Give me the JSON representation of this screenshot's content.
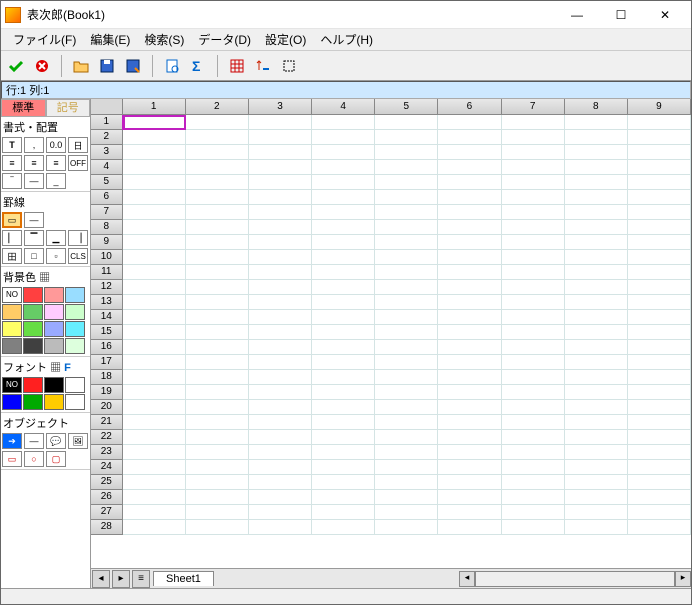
{
  "title": "表次郎(Book1)",
  "menu": {
    "file": "ファイル(F)",
    "edit": "編集(E)",
    "search": "検索(S)",
    "data": "データ(D)",
    "settings": "設定(O)",
    "help": "ヘルプ(H)"
  },
  "location": "行:1 列:1",
  "side": {
    "tab_standard": "標準",
    "tab_symbol": "記号",
    "sect_format": "書式・配置",
    "sect_border": "罫線",
    "sect_bg": "背景色",
    "sect_font": "フォント",
    "sect_object": "オブジェクト",
    "fmt_off": "OFF",
    "cls": "CLS",
    "no": "NO",
    "t_btn": "T",
    "comma_btn": ",",
    "dec_btn": "0.0",
    "date_btn": "日",
    "field_btn": "田"
  },
  "bg_colors": [
    "#ffffff",
    "#ff4040",
    "#ff9999",
    "#99ddff",
    "#ffcc66",
    "#66cc66",
    "#ffccff",
    "#ccffcc",
    "#ffff66",
    "#66dd44",
    "#99aaff",
    "#66eeff",
    "#808080",
    "#404040",
    "#bbbbbb",
    "#ddffdd"
  ],
  "font_colors": [
    "#000000",
    "#ff2020",
    "#000000",
    "#ffffff",
    "#0000ff",
    "#00aa00",
    "#ffcc00",
    "#ffffff"
  ],
  "columns": [
    "1",
    "2",
    "3",
    "4",
    "5",
    "6",
    "7",
    "8",
    "9"
  ],
  "rows": [
    "1",
    "2",
    "3",
    "4",
    "5",
    "6",
    "7",
    "8",
    "9",
    "10",
    "11",
    "12",
    "13",
    "14",
    "15",
    "16",
    "17",
    "18",
    "19",
    "20",
    "21",
    "22",
    "23",
    "24",
    "25",
    "26",
    "27",
    "28"
  ],
  "active_cell": {
    "row": 0,
    "col": 0
  },
  "sheet_tab": "Sheet1"
}
